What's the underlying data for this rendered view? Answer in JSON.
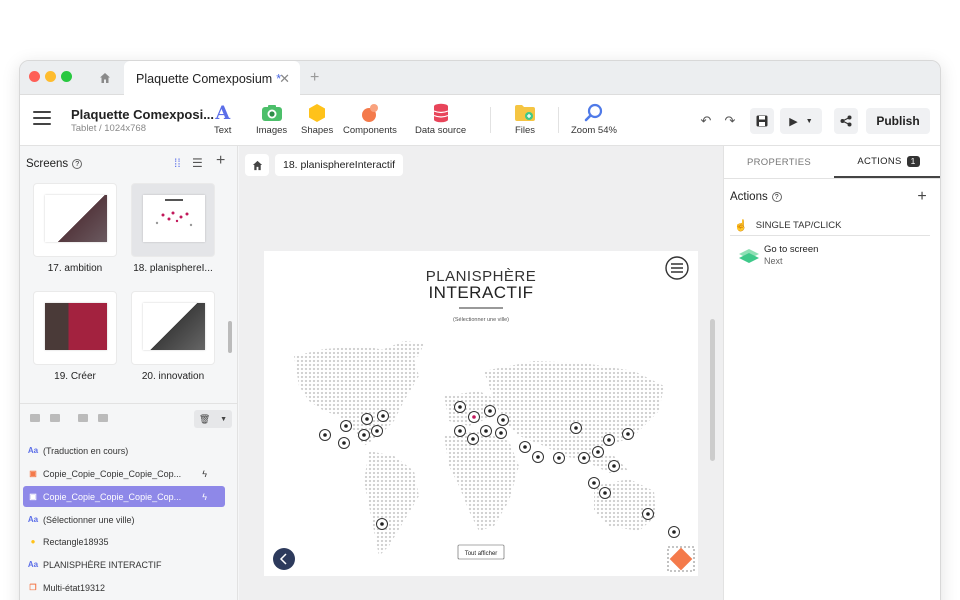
{
  "window": {
    "tab_title": "Plaquette Comexposium",
    "tab_unsaved_mark": "*"
  },
  "toolbar": {
    "project_name": "Plaquette Comexposi...",
    "project_subtitle": "Tablet / 1024x768",
    "tools": [
      {
        "label": "Text",
        "icon": "text-icon"
      },
      {
        "label": "Images",
        "icon": "images-icon"
      },
      {
        "label": "Shapes",
        "icon": "shapes-icon"
      },
      {
        "label": "Components",
        "icon": "components-icon"
      },
      {
        "label": "Data source",
        "icon": "database-icon"
      },
      {
        "label": "Files",
        "icon": "folder-icon"
      },
      {
        "label": "Zoom 54%",
        "icon": "zoom-icon"
      }
    ],
    "publish_label": "Publish"
  },
  "left_panel": {
    "screens_title": "Screens",
    "screens": [
      {
        "label": "17. ambition"
      },
      {
        "label": "18. planisphereI..."
      },
      {
        "label": "19. Créer"
      },
      {
        "label": "20. innovation"
      }
    ],
    "layers": [
      {
        "label": "(Traduction en cours)",
        "icon": "text-layer-icon",
        "selected": false,
        "has_action": false
      },
      {
        "label": "Copie_Copie_Copie_Copie_Cop...",
        "icon": "image-layer-icon",
        "selected": false,
        "has_action": true
      },
      {
        "label": "Copie_Copie_Copie_Copie_Cop...",
        "icon": "image-layer-icon",
        "selected": true,
        "has_action": true
      },
      {
        "label": "(Sélectionner une ville)",
        "icon": "text-layer-icon",
        "selected": false,
        "has_action": false
      },
      {
        "label": "Rectangle18935",
        "icon": "rectangle-layer-icon",
        "selected": false,
        "has_action": false
      },
      {
        "label": "PLANISPHÈRE INTERACTIF",
        "icon": "text-layer-icon",
        "selected": false,
        "has_action": false
      },
      {
        "label": "Multi-état19312",
        "icon": "multistate-layer-icon",
        "selected": false,
        "has_action": false
      }
    ]
  },
  "canvas": {
    "breadcrumb": "18. planisphereInteractif",
    "title_line1": "PLANISPHÈRE",
    "title_line2": "INTERACTIF",
    "subtitle": "(Sélectionner une ville)",
    "button_label": "Tout afficher"
  },
  "right_panel": {
    "tab_properties": "PROPERTIES",
    "tab_actions": "ACTIONS",
    "actions_count": "1",
    "actions_title": "Actions",
    "trigger_label": "SINGLE TAP/CLICK",
    "action_title": "Go to screen",
    "action_target": "Next"
  },
  "colors": {
    "accent": "#4a68e0",
    "selected_layer": "#8e88e8",
    "action_icon": "#3ec98a"
  }
}
